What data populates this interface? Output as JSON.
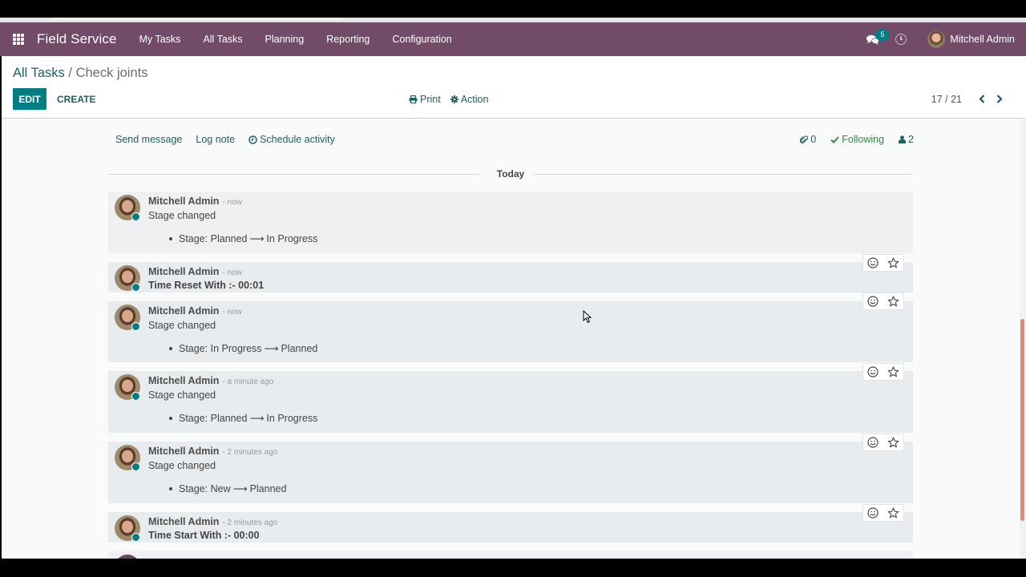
{
  "navbar": {
    "app_name": "Field Service",
    "menu": [
      "My Tasks",
      "All Tasks",
      "Planning",
      "Reporting",
      "Configuration"
    ],
    "messages_badge": "5",
    "user_name": "Mitchell Admin",
    "brand_color": "#714b67"
  },
  "control_panel": {
    "breadcrumb_parent": "All Tasks",
    "breadcrumb_separator": "/",
    "breadcrumb_current": "Check joints",
    "edit_label": "EDIT",
    "create_label": "CREATE",
    "print_label": "Print",
    "action_label": "Action",
    "pager_value": "17 / 21",
    "accent_color": "#017e84"
  },
  "chatter": {
    "send_message": "Send message",
    "log_note": "Log note",
    "schedule_activity": "Schedule activity",
    "attachments_count": "0",
    "following_label": "Following",
    "followers_count": "2",
    "date_separator": "Today",
    "messages": [
      {
        "author": "Mitchell Admin",
        "time": "- now",
        "body": "Stage changed",
        "tracking": {
          "field": "Stage:",
          "old": "Planned",
          "new": "In Progress"
        }
      },
      {
        "author": "Mitchell Admin",
        "time": "- now",
        "body": "Time Reset With :- 00:01"
      },
      {
        "author": "Mitchell Admin",
        "time": "- now",
        "body": "Stage changed",
        "tracking": {
          "field": "Stage:",
          "old": "In Progress",
          "new": "Planned"
        }
      },
      {
        "author": "Mitchell Admin",
        "time": "- a minute ago",
        "body": "Stage changed",
        "tracking": {
          "field": "Stage:",
          "old": "Planned",
          "new": "In Progress"
        }
      },
      {
        "author": "Mitchell Admin",
        "time": "- 2 minutes ago",
        "body": "Stage changed",
        "tracking": {
          "field": "Stage:",
          "old": "New",
          "new": "Planned"
        }
      },
      {
        "author": "Mitchell Admin",
        "time": "- 2 minutes ago",
        "body": "Time Start With :- 00:00"
      }
    ],
    "tracking_arrow": "⟶"
  }
}
